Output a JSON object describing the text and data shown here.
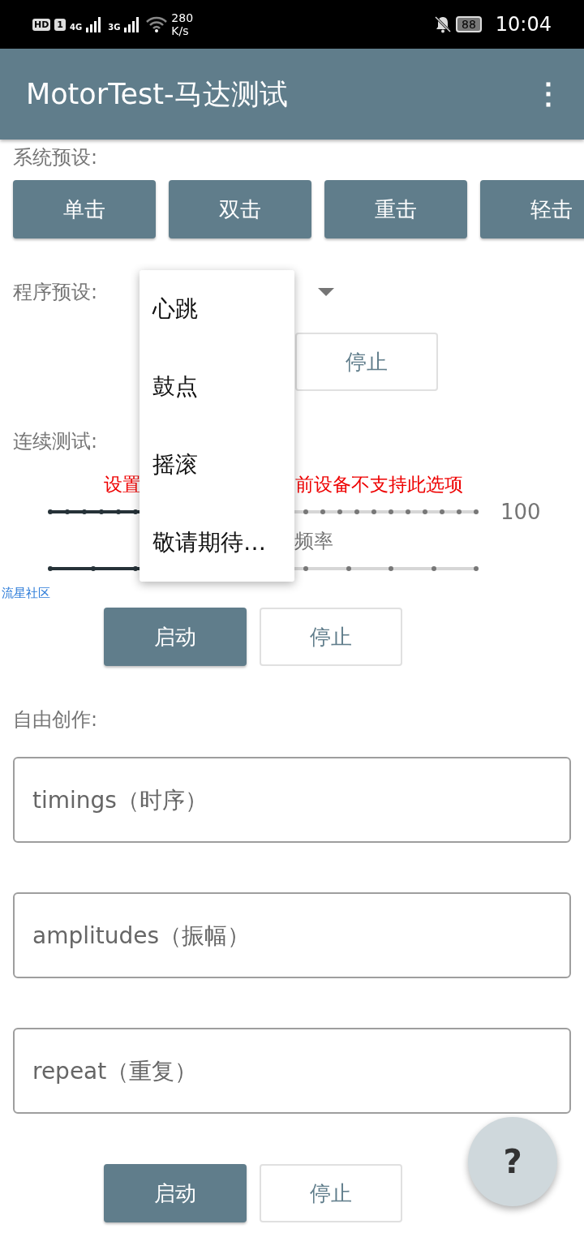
{
  "status_bar": {
    "hd": "HD",
    "sim": "1",
    "network_1": "4G",
    "network_2": "3G",
    "speed": "280",
    "speed_unit": "K/s",
    "battery": "88",
    "time": "10:04"
  },
  "app_bar": {
    "title": "MotorTest-马达测试",
    "menu": "⋮"
  },
  "system_presets": {
    "label": "系统预设:",
    "buttons": [
      "单击",
      "双击",
      "重击",
      "轻击"
    ]
  },
  "program_presets": {
    "label": "程序预设:",
    "stop": "停止"
  },
  "continuous_test": {
    "label": "连续测试:",
    "warning_left": "设置",
    "warning_right": "前设备不支持此选项",
    "sliders": [
      {
        "level": 0.39,
        "reading": "100"
      },
      {
        "level": 0.5,
        "caption": "频率"
      }
    ],
    "watermark_link": "流星社区",
    "start": "启动",
    "stop": "停止"
  },
  "free_creation": {
    "label": "自由创作:",
    "fields": [
      {
        "placeholder": "timings（时序）"
      },
      {
        "placeholder": "amplitudes（振幅）"
      },
      {
        "placeholder": "repeat（重复）"
      }
    ],
    "start": "启动",
    "stop": "停止"
  },
  "dropdown_menu": {
    "items": [
      "心跳",
      "鼓点",
      "摇滚",
      "敬请期待…"
    ]
  },
  "help_button": "?"
}
